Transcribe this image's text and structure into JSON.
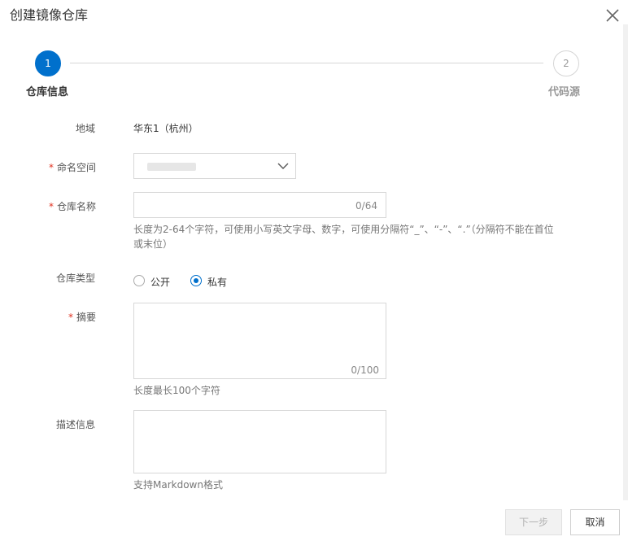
{
  "dialog": {
    "title": "创建镜像仓库",
    "close_icon": "close-icon"
  },
  "steps": [
    {
      "number": "1",
      "label": "仓库信息",
      "state": "active"
    },
    {
      "number": "2",
      "label": "代码源",
      "state": "pending"
    }
  ],
  "form": {
    "region": {
      "label": "地域",
      "value": "华东1（杭州）"
    },
    "namespace": {
      "label": "命名空间",
      "required_mark": "*",
      "icon": "chevron-down-icon"
    },
    "repo_name": {
      "label": "仓库名称",
      "required_mark": "*",
      "value": "",
      "counter": "0/64",
      "help_line1": "长度为2-64个字符，可使用小写英文字母、数字，可使用分隔符“_”、“-”、“.”（分隔符不能在首位",
      "help_line2": "或末位）"
    },
    "repo_type": {
      "label": "仓库类型",
      "options": [
        {
          "label": "公开",
          "selected": false
        },
        {
          "label": "私有",
          "selected": true
        }
      ]
    },
    "summary": {
      "label": "摘要",
      "required_mark": "*",
      "value": "",
      "counter": "0/100",
      "help": "长度最长100个字符"
    },
    "description": {
      "label": "描述信息",
      "value": "",
      "help": "支持Markdown格式"
    }
  },
  "footer": {
    "next_label": "下一步",
    "cancel_label": "取消"
  },
  "colors": {
    "primary": "#0070cc",
    "required": "#e0301e",
    "border": "#d7d7d7"
  }
}
